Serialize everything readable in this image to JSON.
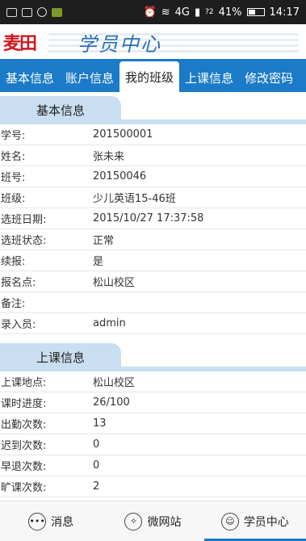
{
  "status_bar": {
    "network": "4G",
    "signal_extra": "?2",
    "battery": "41%",
    "battery_level": 0.41,
    "time": "14:17"
  },
  "header": {
    "logo_text": "麦田",
    "title": "学员中心"
  },
  "tabs": [
    {
      "label": "基本信息",
      "active": false
    },
    {
      "label": "账户信息",
      "active": false
    },
    {
      "label": "我的班级",
      "active": true
    },
    {
      "label": "上课信息",
      "active": false
    },
    {
      "label": "修改密码",
      "active": false
    }
  ],
  "section_basic": {
    "title": "基本信息",
    "rows": [
      {
        "key": "学号:",
        "value": "201500001"
      },
      {
        "key": "姓名:",
        "value": "张未来"
      },
      {
        "key": "班号:",
        "value": "20150046"
      },
      {
        "key": "班级:",
        "value": "少儿英语15-46班"
      },
      {
        "key": "选班日期:",
        "value": "2015/10/27 17:37:58"
      },
      {
        "key": "选班状态:",
        "value": "正常"
      },
      {
        "key": "续报:",
        "value": "是"
      },
      {
        "key": "报名点:",
        "value": "松山校区"
      },
      {
        "key": "备注:",
        "value": ""
      },
      {
        "key": "录入员:",
        "value": "admin"
      }
    ]
  },
  "section_class": {
    "title": "上课信息",
    "rows": [
      {
        "key": "上课地点:",
        "value": "松山校区"
      },
      {
        "key": "课时进度:",
        "value": "26/100"
      },
      {
        "key": "出勤次数:",
        "value": "13"
      },
      {
        "key": "迟到次数:",
        "value": "0"
      },
      {
        "key": "早退次数:",
        "value": "0"
      },
      {
        "key": "旷课次数:",
        "value": "2"
      }
    ]
  },
  "bottom_nav": [
    {
      "label": "消息",
      "icon": "message-icon",
      "active": false
    },
    {
      "label": "微网站",
      "icon": "compass-icon",
      "active": false
    },
    {
      "label": "学员中心",
      "icon": "user-icon",
      "active": true
    }
  ]
}
